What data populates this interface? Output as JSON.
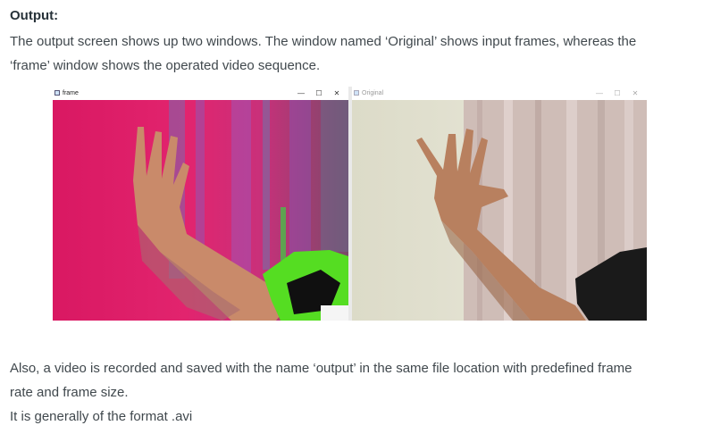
{
  "article": {
    "heading": "Output:",
    "intro": "The output screen shows up two windows. The window named ‘Original’ shows input frames, whereas the",
    "intro_cont": "‘frame’ window shows the operated video sequence.",
    "after_1": "Also, a video is recorded and saved with the name ‘output’ in the same file location with predefined frame",
    "after_2": "rate and frame size.",
    "after_3": "It is generally of the format .avi"
  },
  "screenshot": {
    "frame_window": {
      "title": "frame",
      "icon": "app-window-icon",
      "buttons": {
        "minimize": "—",
        "maximize": "☐",
        "close": "✕"
      }
    },
    "original_window": {
      "title": "Original",
      "icon": "app-window-icon",
      "buttons": {
        "minimize": "—",
        "maximize": "☐",
        "close": "✕"
      }
    }
  },
  "colors": {
    "text": "#40484d",
    "heading": "#273239",
    "frame_bg": "#e0206a",
    "frame_hand": "#c98a6a",
    "frame_green": "#55dd22",
    "wall": "#e4e2d3",
    "curtain": "#cdb9b4",
    "skin": "#b8805f"
  }
}
